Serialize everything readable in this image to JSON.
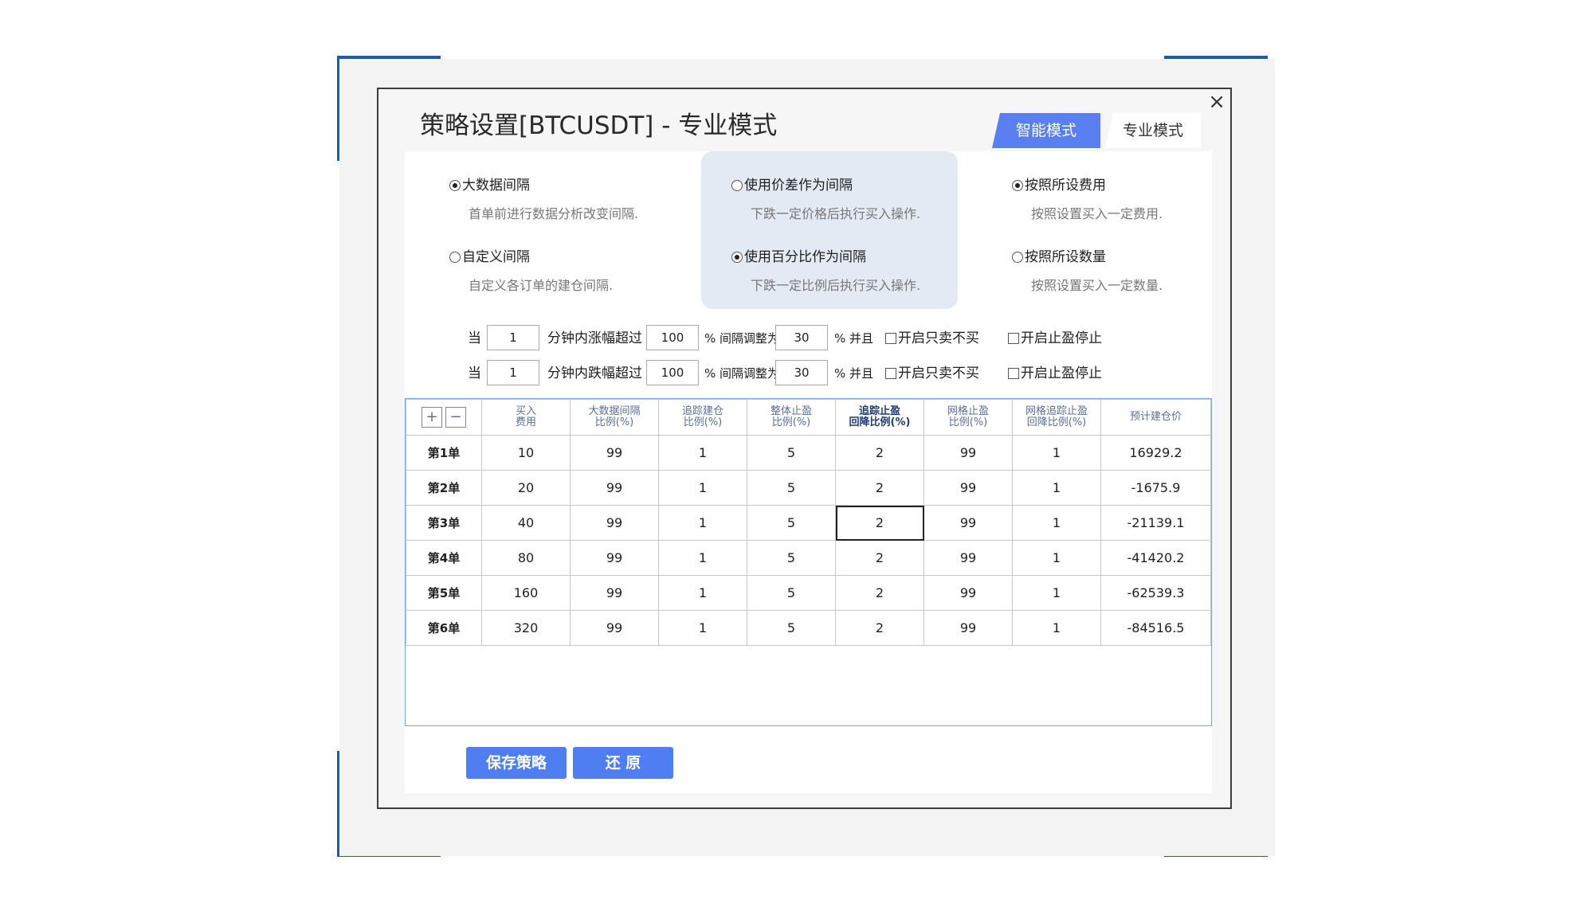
{
  "dialog": {
    "title": "策略设置[BTCUSDT] - 专业模式",
    "close": "×",
    "tabs": [
      {
        "label": "智能模式",
        "active": true
      },
      {
        "label": "专业模式",
        "active": false
      }
    ]
  },
  "options": {
    "bigdata": {
      "label": "大数据间隔",
      "desc": "首单前进行数据分析改变间隔.",
      "checked": true
    },
    "custom": {
      "label": "自定义间隔",
      "desc": "自定义各订单的建仓间隔.",
      "checked": false
    },
    "price_diff": {
      "label": "使用价差作为间隔",
      "desc": "下跌一定价格后执行买入操作.",
      "checked": false
    },
    "percent": {
      "label": "使用百分比作为间隔",
      "desc": "下跌一定比例后执行买入操作.",
      "checked": true
    },
    "by_fee": {
      "label": "按照所设费用",
      "desc": "按照设置买入一定费用.",
      "checked": true
    },
    "by_qty": {
      "label": "按照所设数量",
      "desc": "按照设置买入一定数量.",
      "checked": false
    }
  },
  "conditions": [
    {
      "when": "当",
      "minutes": "1",
      "text1": "分钟内涨幅超过",
      "pct": "100",
      "text2": "% 间隔调整为",
      "adj": "30",
      "text3": "% 并且",
      "check1": "开启只卖不买",
      "check2": "开启止盈停止"
    },
    {
      "when": "当",
      "minutes": "1",
      "text1": "分钟内跌幅超过",
      "pct": "100",
      "text2": "% 间隔调整为",
      "adj": "30",
      "text3": "% 并且",
      "check1": "开启只卖不买",
      "check2": "开启止盈停止"
    }
  ],
  "table": {
    "plus": "+",
    "minus": "−",
    "headers": [
      [
        "买入",
        "费用"
      ],
      [
        "大数据间隔",
        "比例(%)"
      ],
      [
        "追踪建仓",
        "比例(%)"
      ],
      [
        "整体止盈",
        "比例(%)"
      ],
      [
        "追踪止盈",
        "回降比例(%)"
      ],
      [
        "网格止盈",
        "比例(%)"
      ],
      [
        "网格追踪止盈",
        "回降比例(%)"
      ],
      [
        "预计建仓价"
      ]
    ],
    "rows": [
      {
        "label": "第1单",
        "cells": [
          "10",
          "99",
          "1",
          "5",
          "2",
          "99",
          "1",
          "16929.2"
        ]
      },
      {
        "label": "第2单",
        "cells": [
          "20",
          "99",
          "1",
          "5",
          "2",
          "99",
          "1",
          "-1675.9"
        ]
      },
      {
        "label": "第3单",
        "cells": [
          "40",
          "99",
          "1",
          "5",
          "2",
          "99",
          "1",
          "-21139.1"
        ]
      },
      {
        "label": "第4单",
        "cells": [
          "80",
          "99",
          "1",
          "5",
          "2",
          "99",
          "1",
          "-41420.2"
        ]
      },
      {
        "label": "第5单",
        "cells": [
          "160",
          "99",
          "1",
          "5",
          "2",
          "99",
          "1",
          "-62539.3"
        ]
      },
      {
        "label": "第6单",
        "cells": [
          "320",
          "99",
          "1",
          "5",
          "2",
          "99",
          "1",
          "-84516.5"
        ]
      }
    ]
  },
  "buttons": {
    "save": "保存策略",
    "restore": "还 原"
  },
  "colors": {
    "accent": "#4e7ef2",
    "frame": "#1f5aa6"
  }
}
